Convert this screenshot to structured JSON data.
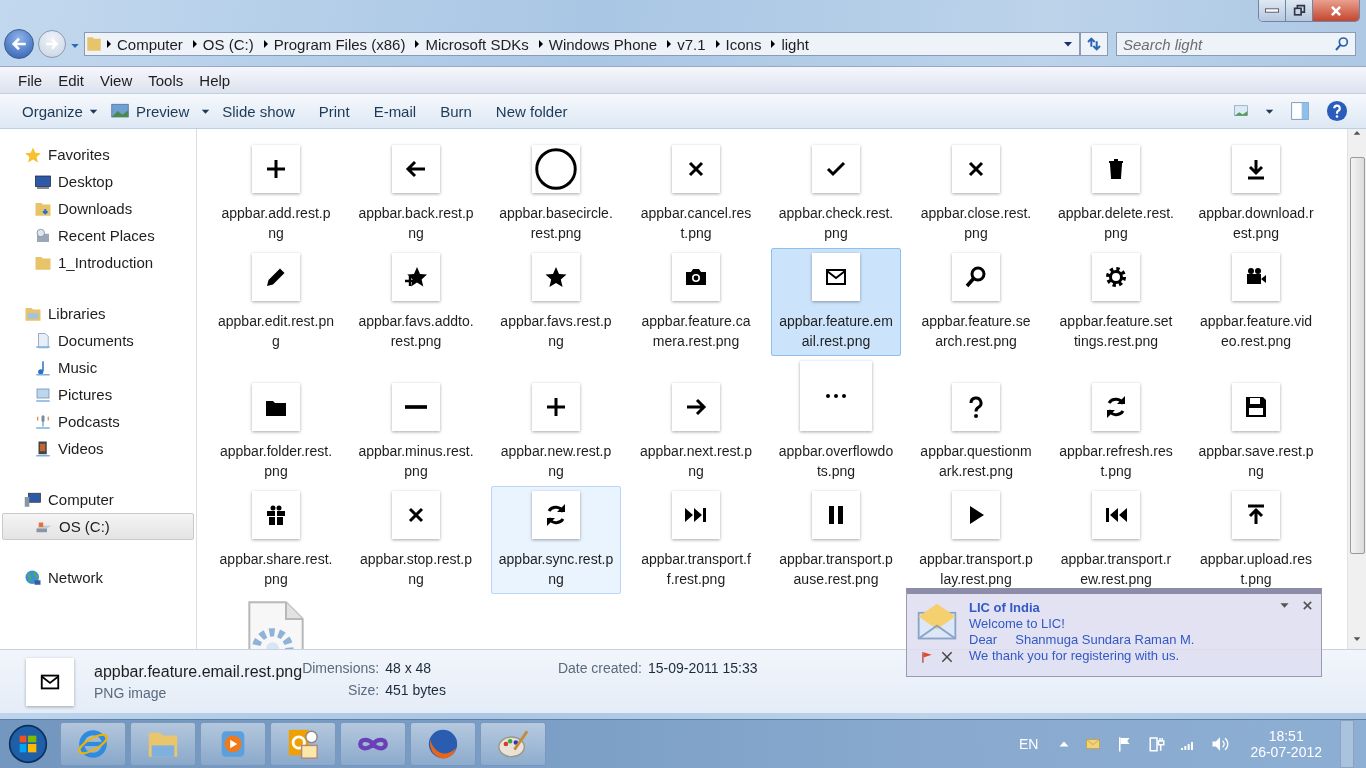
{
  "address": {
    "crumbs": [
      "Computer",
      "OS (C:)",
      "Program Files (x86)",
      "Microsoft SDKs",
      "Windows Phone",
      "v7.1",
      "Icons",
      "light"
    ]
  },
  "search": {
    "placeholder": "Search light"
  },
  "menu": [
    "File",
    "Edit",
    "View",
    "Tools",
    "Help"
  ],
  "toolbar": [
    {
      "label": "Organize",
      "kind": "dropdown"
    },
    {
      "label": "Preview",
      "kind": "preview"
    },
    {
      "label": "Slide show",
      "kind": "plain"
    },
    {
      "label": "Print",
      "kind": "plain"
    },
    {
      "label": "E-mail",
      "kind": "plain"
    },
    {
      "label": "Burn",
      "kind": "plain"
    },
    {
      "label": "New folder",
      "kind": "plain"
    }
  ],
  "sidebar": {
    "groups": [
      {
        "label": "Favorites",
        "selected": false,
        "children": [
          {
            "label": "Desktop",
            "selected": false
          },
          {
            "label": "Downloads",
            "selected": false
          },
          {
            "label": "Recent Places",
            "selected": false
          },
          {
            "label": "1_Introduction",
            "selected": false
          }
        ]
      },
      {
        "label": "Libraries",
        "selected": false,
        "children": [
          {
            "label": "Documents",
            "selected": false
          },
          {
            "label": "Music",
            "selected": false
          },
          {
            "label": "Pictures",
            "selected": false
          },
          {
            "label": "Podcasts",
            "selected": false
          },
          {
            "label": "Videos",
            "selected": false
          }
        ]
      },
      {
        "label": "Computer",
        "selected": false,
        "children": [
          {
            "label": "OS (C:)",
            "selected": true
          }
        ]
      },
      {
        "label": "Network",
        "selected": false
      }
    ]
  },
  "files": [
    {
      "name": "appbar.add.rest.png",
      "kind": "add",
      "selected": false,
      "hovered": false
    },
    {
      "name": "appbar.back.rest.png",
      "kind": "back",
      "selected": false,
      "hovered": false
    },
    {
      "name": "appbar.basecircle.rest.png",
      "kind": "basecircle",
      "selected": false,
      "hovered": false
    },
    {
      "name": "appbar.cancel.rest.png",
      "kind": "cancel",
      "selected": false,
      "hovered": false
    },
    {
      "name": "appbar.check.rest.png",
      "kind": "check",
      "selected": false,
      "hovered": false
    },
    {
      "name": "appbar.close.rest.png",
      "kind": "close",
      "selected": false,
      "hovered": false
    },
    {
      "name": "appbar.delete.rest.png",
      "kind": "delete",
      "selected": false,
      "hovered": false
    },
    {
      "name": "appbar.download.rest.png",
      "kind": "download",
      "selected": false,
      "hovered": false
    },
    {
      "name": "appbar.edit.rest.png",
      "kind": "edit",
      "selected": false,
      "hovered": false
    },
    {
      "name": "appbar.favs.addto.rest.png",
      "kind": "favsadd",
      "selected": false,
      "hovered": false
    },
    {
      "name": "appbar.favs.rest.png",
      "kind": "favs",
      "selected": false,
      "hovered": false
    },
    {
      "name": "appbar.feature.camera.rest.png",
      "kind": "camera",
      "selected": false,
      "hovered": false
    },
    {
      "name": "appbar.feature.email.rest.png",
      "kind": "email",
      "selected": true,
      "hovered": false
    },
    {
      "name": "appbar.feature.search.rest.png",
      "kind": "search",
      "selected": false,
      "hovered": false
    },
    {
      "name": "appbar.feature.settings.rest.png",
      "kind": "settings",
      "selected": false,
      "hovered": false
    },
    {
      "name": "appbar.feature.video.rest.png",
      "kind": "video",
      "selected": false,
      "hovered": false
    },
    {
      "name": "appbar.folder.rest.png",
      "kind": "folder",
      "selected": false,
      "hovered": false
    },
    {
      "name": "appbar.minus.rest.png",
      "kind": "minus",
      "selected": false,
      "hovered": false
    },
    {
      "name": "appbar.new.rest.png",
      "kind": "new",
      "selected": false,
      "hovered": false
    },
    {
      "name": "appbar.next.rest.png",
      "kind": "next",
      "selected": false,
      "hovered": false
    },
    {
      "name": "appbar.overflowdots.png",
      "kind": "overflow",
      "selected": false,
      "hovered": false
    },
    {
      "name": "appbar.questionmark.rest.png",
      "kind": "question",
      "selected": false,
      "hovered": false
    },
    {
      "name": "appbar.refresh.rest.png",
      "kind": "refresh",
      "selected": false,
      "hovered": false
    },
    {
      "name": "appbar.save.rest.png",
      "kind": "save",
      "selected": false,
      "hovered": false
    },
    {
      "name": "appbar.share.rest.png",
      "kind": "share",
      "selected": false,
      "hovered": false
    },
    {
      "name": "appbar.stop.rest.png",
      "kind": "stop",
      "selected": false,
      "hovered": false
    },
    {
      "name": "appbar.sync.rest.png",
      "kind": "sync",
      "selected": false,
      "hovered": true
    },
    {
      "name": "appbar.transport.ff.rest.png",
      "kind": "ff",
      "selected": false,
      "hovered": false
    },
    {
      "name": "appbar.transport.pause.rest.png",
      "kind": "pause",
      "selected": false,
      "hovered": false
    },
    {
      "name": "appbar.transport.play.rest.png",
      "kind": "play",
      "selected": false,
      "hovered": false
    },
    {
      "name": "appbar.transport.rew.rest.png",
      "kind": "rew",
      "selected": false,
      "hovered": false
    },
    {
      "name": "appbar.upload.rest.png",
      "kind": "upload",
      "selected": false,
      "hovered": false
    },
    {
      "kind": "file",
      "selected": false,
      "hovered": false
    }
  ],
  "details": {
    "kind": "email",
    "name": "appbar.feature.email.rest.png",
    "type": "PNG image",
    "fields": [
      {
        "label": "Dimensions:",
        "value": "48 x 48"
      },
      {
        "label": "Size:",
        "value": "451 bytes"
      },
      {
        "label": "Date created:",
        "value": "15-09-2011 15:33"
      }
    ]
  },
  "notification": {
    "title": "LIC of India",
    "lines": [
      "Welcome to LIC!",
      "Dear     Shanmuga Sundara Raman M.",
      "We thank you for registering with us."
    ]
  },
  "taskbar": {
    "language": "EN",
    "time": "18:51",
    "date": "26-07-2012"
  }
}
